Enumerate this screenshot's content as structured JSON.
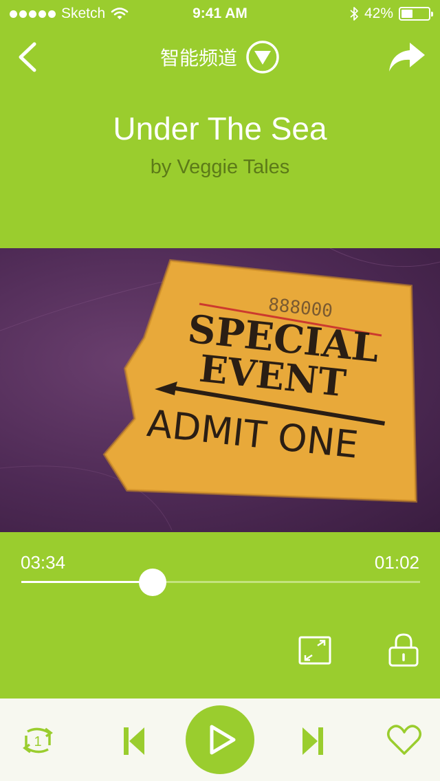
{
  "status_bar": {
    "carrier": "Sketch",
    "time": "9:41 AM",
    "battery": "42%",
    "battery_level": 0.42
  },
  "nav": {
    "title": "智能频道"
  },
  "song": {
    "title": "Under The Sea",
    "artist": "by Veggie Tales"
  },
  "album_art": {
    "ticket_number": "888000",
    "ticket_line1": "SPECIAL",
    "ticket_line2": "EVENT",
    "ticket_line3": "ADMIT ONE"
  },
  "progress": {
    "elapsed": "03:34",
    "remaining": "01:02",
    "fraction": 0.33
  },
  "controls": {
    "repeat_count": "1"
  },
  "colors": {
    "accent": "#9acd2e",
    "artist_text": "#5c7a18",
    "track_unplayed": "#c4e37e",
    "controls_bg": "#f7f8f0"
  },
  "icons": [
    "back-icon",
    "dropdown-icon",
    "share-icon",
    "expand-icon",
    "lock-icon",
    "repeat-one-icon",
    "previous-icon",
    "play-icon",
    "next-icon",
    "heart-icon"
  ]
}
